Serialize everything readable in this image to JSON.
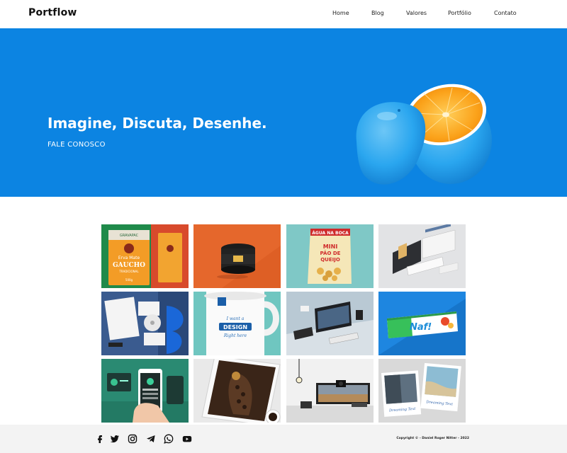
{
  "header": {
    "logo": "Portflow",
    "nav": [
      {
        "label": "Home"
      },
      {
        "label": "Blog"
      },
      {
        "label": "Valores"
      },
      {
        "label": "Portfólio"
      },
      {
        "label": "Contato"
      }
    ]
  },
  "hero": {
    "title": "Imagine, Discuta, Desenhe.",
    "cta": "FALE CONOSCO",
    "background_color": "#0c84e2"
  },
  "gallery": {
    "items": [
      {
        "name": "erva-mate-packaging",
        "text_top": "GRAVAPAC",
        "text_main": "Erva Mate",
        "text_brand": "GAUCHO",
        "text_sub": "TRADICIONAL",
        "text_weight": "500g"
      },
      {
        "name": "jar-mockup"
      },
      {
        "name": "snack-bag",
        "text_top": "ÁGUA NA BOCA",
        "text_main": "MINI PÃO DE QUEIJO"
      },
      {
        "name": "website-mockup"
      },
      {
        "name": "stationery-mockup"
      },
      {
        "name": "mug-mockup",
        "text_top": "I want a",
        "text_main": "DESIGN",
        "text_sub": "Right here"
      },
      {
        "name": "workspace-mockup"
      },
      {
        "name": "candy-bar",
        "text_main": "Naf!"
      },
      {
        "name": "mobile-app-mockup"
      },
      {
        "name": "tablet-coffee-mockup"
      },
      {
        "name": "photo-studio"
      },
      {
        "name": "polaroid-photos",
        "text_left": "Dreaming Text",
        "text_right": "Dreaming Text"
      }
    ]
  },
  "footer": {
    "social": [
      "facebook-icon",
      "twitter-icon",
      "instagram-icon",
      "telegram-icon",
      "whatsapp-icon",
      "youtube-icon"
    ],
    "copyright": "Copyright © - Daniel Roger Nitter - 2022"
  }
}
